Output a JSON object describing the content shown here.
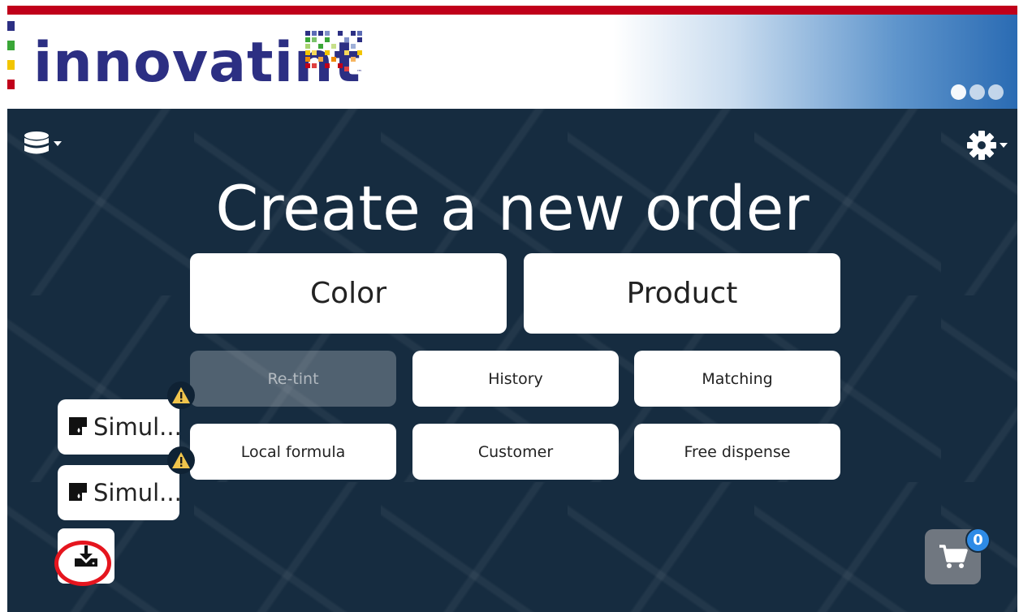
{
  "header": {
    "logo_text": "innovatint",
    "brand_red": "#c0001a",
    "brand_blue": "#2c2f83",
    "loading_dots": 3
  },
  "toolbar": {
    "database_icon": "database-icon",
    "settings_icon": "gear-icon"
  },
  "main": {
    "title": "Create a new order",
    "primary_buttons": [
      "Color",
      "Product"
    ],
    "secondary_buttons": [
      {
        "label": "Re-tint",
        "disabled": true
      },
      {
        "label": "History",
        "disabled": false
      },
      {
        "label": "Matching",
        "disabled": false
      },
      {
        "label": "Local formula",
        "disabled": false
      },
      {
        "label": "Customer",
        "disabled": false
      },
      {
        "label": "Free dispense",
        "disabled": false
      }
    ]
  },
  "machines": [
    {
      "label": "Simul...",
      "icon": "dispenser-icon",
      "status_icon": "warning-icon"
    },
    {
      "label": "Simul...",
      "icon": "dispenser-icon",
      "status_icon": "warning-icon"
    }
  ],
  "download": {
    "icon": "download-icon",
    "highlight_color": "#e5151e"
  },
  "cart": {
    "icon": "cart-icon",
    "count": "0",
    "badge_color": "#2e8be6"
  }
}
